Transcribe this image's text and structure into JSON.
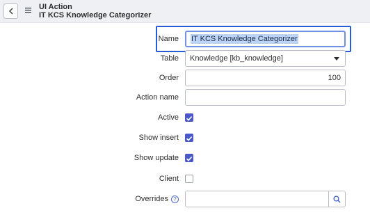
{
  "header": {
    "record_type": "UI Action",
    "record_title": "IT KCS Knowledge Categorizer",
    "back_icon": "chevron-left-icon",
    "menu_icon": "hamburger-icon"
  },
  "form": {
    "name": {
      "label": "Name",
      "value": "IT KCS Knowledge Categorizer"
    },
    "table": {
      "label": "Table",
      "value": "Knowledge [kb_knowledge]"
    },
    "order": {
      "label": "Order",
      "value": "100"
    },
    "action_name": {
      "label": "Action name",
      "value": ""
    },
    "active": {
      "label": "Active",
      "checked": true
    },
    "show_insert": {
      "label": "Show insert",
      "checked": true
    },
    "show_update": {
      "label": "Show update",
      "checked": true
    },
    "client": {
      "label": "Client",
      "checked": false
    },
    "overrides": {
      "label": "Overrides",
      "value": "",
      "help_icon": "question-circle-icon",
      "search_icon": "search-icon"
    }
  },
  "colors": {
    "accent": "#2a5bd7",
    "checkbox": "#4a57c9",
    "selection": "#bad3f7"
  }
}
